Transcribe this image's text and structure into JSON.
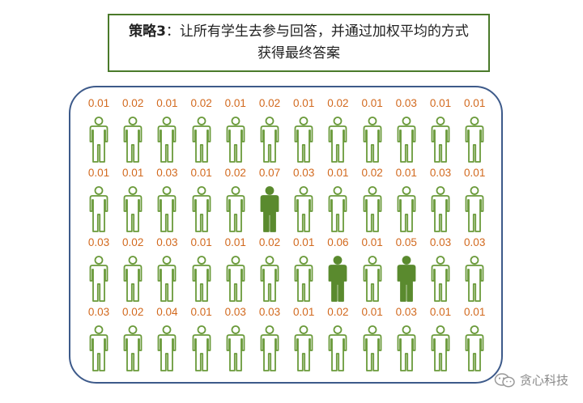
{
  "title": {
    "strong": "策略3",
    "rest": "：让所有学生去参与回答，并通过加权平均的方式获得最终答案"
  },
  "colors": {
    "outline": "#6a9a3a",
    "filled": "#5a8a2e",
    "weight_text": "#d2691e",
    "panel_border": "#3d5a8a",
    "title_border": "#4a7a2a"
  },
  "people": [
    [
      {
        "w": "0.01",
        "filled": false
      },
      {
        "w": "0.02",
        "filled": false
      },
      {
        "w": "0.01",
        "filled": false
      },
      {
        "w": "0.02",
        "filled": false
      },
      {
        "w": "0.01",
        "filled": false
      },
      {
        "w": "0.02",
        "filled": false
      },
      {
        "w": "0.01",
        "filled": false
      },
      {
        "w": "0.02",
        "filled": false
      },
      {
        "w": "0.01",
        "filled": false
      },
      {
        "w": "0.03",
        "filled": false
      },
      {
        "w": "0.01",
        "filled": false
      },
      {
        "w": "0.01",
        "filled": false
      }
    ],
    [
      {
        "w": "0.01",
        "filled": false
      },
      {
        "w": "0.01",
        "filled": false
      },
      {
        "w": "0.03",
        "filled": false
      },
      {
        "w": "0.01",
        "filled": false
      },
      {
        "w": "0.02",
        "filled": false
      },
      {
        "w": "0.07",
        "filled": true
      },
      {
        "w": "0.03",
        "filled": false
      },
      {
        "w": "0.01",
        "filled": false
      },
      {
        "w": "0.02",
        "filled": false
      },
      {
        "w": "0.01",
        "filled": false
      },
      {
        "w": "0.03",
        "filled": false
      },
      {
        "w": "0.01",
        "filled": false
      }
    ],
    [
      {
        "w": "0.03",
        "filled": false
      },
      {
        "w": "0.02",
        "filled": false
      },
      {
        "w": "0.03",
        "filled": false
      },
      {
        "w": "0.01",
        "filled": false
      },
      {
        "w": "0.01",
        "filled": false
      },
      {
        "w": "0.02",
        "filled": false
      },
      {
        "w": "0.01",
        "filled": false
      },
      {
        "w": "0.06",
        "filled": true
      },
      {
        "w": "0.01",
        "filled": false
      },
      {
        "w": "0.05",
        "filled": true
      },
      {
        "w": "0.03",
        "filled": false
      },
      {
        "w": "0.03",
        "filled": false
      }
    ],
    [
      {
        "w": "0.03",
        "filled": false
      },
      {
        "w": "0.02",
        "filled": false
      },
      {
        "w": "0.04",
        "filled": false
      },
      {
        "w": "0.01",
        "filled": false
      },
      {
        "w": "0.03",
        "filled": false
      },
      {
        "w": "0.03",
        "filled": false
      },
      {
        "w": "0.01",
        "filled": false
      },
      {
        "w": "0.02",
        "filled": false
      },
      {
        "w": "0.01",
        "filled": false
      },
      {
        "w": "0.03",
        "filled": false
      },
      {
        "w": "0.01",
        "filled": false
      },
      {
        "w": "0.01",
        "filled": false
      }
    ]
  ],
  "watermark": {
    "icon": "wechat-icon",
    "text": "贪心科技"
  }
}
